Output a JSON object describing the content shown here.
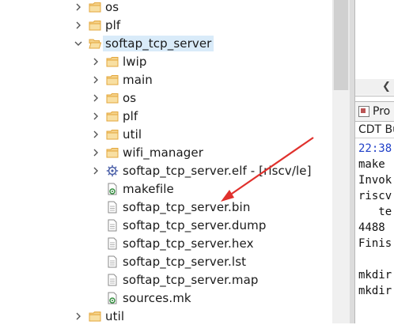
{
  "tree": {
    "items": [
      {
        "label": "os",
        "twisty": "collapsed",
        "icon": "folder-icon",
        "depth": 0,
        "selected": false
      },
      {
        "label": "plf",
        "twisty": "collapsed",
        "icon": "folder-icon",
        "depth": 0,
        "selected": false
      },
      {
        "label": "softap_tcp_server",
        "twisty": "expanded",
        "icon": "folder-open-icon",
        "depth": 0,
        "selected": true
      },
      {
        "label": "lwip",
        "twisty": "collapsed",
        "icon": "folder-icon",
        "depth": 1,
        "selected": false
      },
      {
        "label": "main",
        "twisty": "collapsed",
        "icon": "folder-icon",
        "depth": 1,
        "selected": false
      },
      {
        "label": "os",
        "twisty": "collapsed",
        "icon": "folder-icon",
        "depth": 1,
        "selected": false
      },
      {
        "label": "plf",
        "twisty": "collapsed",
        "icon": "folder-icon",
        "depth": 1,
        "selected": false
      },
      {
        "label": "util",
        "twisty": "collapsed",
        "icon": "folder-icon",
        "depth": 1,
        "selected": false
      },
      {
        "label": "wifi_manager",
        "twisty": "collapsed",
        "icon": "folder-icon",
        "depth": 1,
        "selected": false
      },
      {
        "label": "softap_tcp_server.elf - [riscv/le]",
        "twisty": "collapsed",
        "icon": "binary-gear-icon",
        "depth": 1,
        "selected": false
      },
      {
        "label": "makefile",
        "twisty": "none",
        "icon": "makefile-icon",
        "depth": 1,
        "selected": false
      },
      {
        "label": "softap_tcp_server.bin",
        "twisty": "none",
        "icon": "file-icon",
        "depth": 1,
        "selected": false
      },
      {
        "label": "softap_tcp_server.dump",
        "twisty": "none",
        "icon": "file-icon",
        "depth": 1,
        "selected": false
      },
      {
        "label": "softap_tcp_server.hex",
        "twisty": "none",
        "icon": "file-icon",
        "depth": 1,
        "selected": false
      },
      {
        "label": "softap_tcp_server.lst",
        "twisty": "none",
        "icon": "file-icon",
        "depth": 1,
        "selected": false
      },
      {
        "label": "softap_tcp_server.map",
        "twisty": "none",
        "icon": "file-icon",
        "depth": 1,
        "selected": false
      },
      {
        "label": "sources.mk",
        "twisty": "none",
        "icon": "makefile-icon",
        "depth": 1,
        "selected": false
      },
      {
        "label": "util",
        "twisty": "collapsed",
        "icon": "folder-icon",
        "depth": 0,
        "selected": false
      }
    ]
  },
  "right_panel": {
    "tab_label": "Pro",
    "sub_label": "CDT Bu",
    "console_lines": [
      "22:38",
      "make",
      "Invok",
      "riscv",
      "   te",
      "4488",
      "Finis",
      "",
      "mkdir",
      "mkdir"
    ]
  },
  "colors": {
    "folder": "#e3a73c",
    "selection": "#d9ebf9",
    "arrow": "#e0312d",
    "console_time": "#1f3fc8"
  }
}
